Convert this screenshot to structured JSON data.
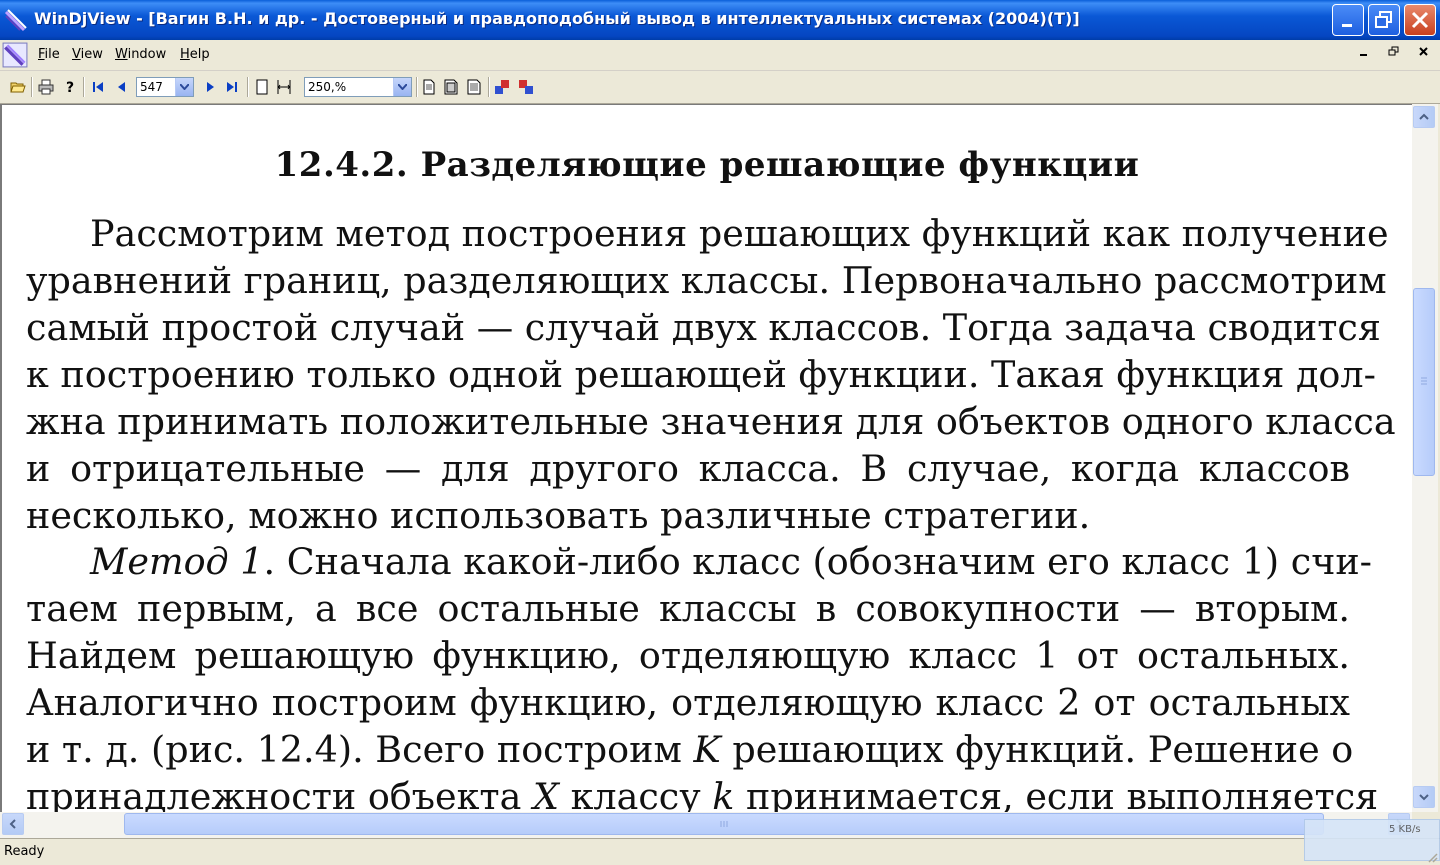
{
  "window": {
    "title": "WinDjView - [Вагин В.Н. и др. - Достоверный и правдоподобный вывод в интеллектуальных системах (2004)(T)]"
  },
  "menu": {
    "items": [
      {
        "label": "File",
        "accel": "F",
        "rest": "ile"
      },
      {
        "label": "View",
        "accel": "V",
        "rest": "iew"
      },
      {
        "label": "Window",
        "accel": "W",
        "rest": "indow"
      },
      {
        "label": "Help",
        "accel": "H",
        "rest": "elp"
      }
    ]
  },
  "toolbar": {
    "page_number": "547",
    "zoom": "250,%"
  },
  "document": {
    "heading": "12.4.2.  Разделяющие решающие функции",
    "lines": [
      "Рассмотрим метод построения решающих функций как получение",
      "уравнений границ, разделяющих классы. Первоначально рассмотрим",
      "самый простой случай — случай двух классов. Тогда задача сводится",
      "к построению только одной решающей функции. Такая функция дол-",
      "жна принимать положительные значения для объектов одного класса",
      "и отрицательные — для другого класса. В случае, когда классов",
      "несколько, можно использовать различные стратегии."
    ],
    "p2_italic": "Метод 1",
    "p2_first_rest": ". Сначала какой-либо класс (обозначим его класс 1) счи-",
    "p2_lines": [
      "таем первым, а все остальные классы в совокупности — вторым.",
      "Найдем решающую функцию, отделяющую класс 1 от остальных.",
      "Аналогично построим функцию, отделяющую класс 2 от остальных"
    ],
    "p2_line5_a": "и т. д. (рис. 12.4). Всего построим ",
    "p2_line5_K": "K",
    "p2_line5_b": " решающих функций. Решение о",
    "p2_line6_a": "принадлежности объекта ",
    "p2_line6_X": "X",
    "p2_line6_b": " классу ",
    "p2_line6_k": "k",
    "p2_line6_c": " принимается, если выполняется"
  },
  "status": {
    "text": "Ready",
    "net_rate": "5 KB/s"
  }
}
